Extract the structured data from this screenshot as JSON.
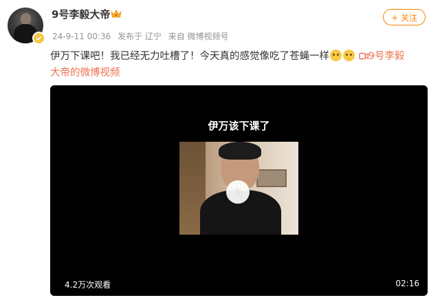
{
  "user": {
    "name": "9号李毅大帝",
    "badge_icon": "crown-icon",
    "verified_icon": "verified-check-icon"
  },
  "meta": {
    "timestamp": "24-9-11 00:36",
    "location": "发布于 辽宁",
    "source": "来自 微博视频号"
  },
  "follow_button": {
    "label": "+ 关注"
  },
  "post": {
    "text": "伊万下课吧！我已经无力吐槽了！今天真的感觉像吃了苍蝇一样",
    "emojis": [
      "crying-face-icon",
      "crying-face-icon"
    ],
    "link_icon": "video-camera-icon",
    "link_text_line1": "9号李毅",
    "link_text_line2": "大帝的微博视频"
  },
  "video": {
    "caption": "伊万该下课了",
    "play_icon": "play-icon",
    "views": "4.2万次观看",
    "duration": "02:16"
  },
  "colors": {
    "accent": "#ff8200",
    "link": "#eb7350",
    "text": "#333333",
    "meta": "#939393"
  }
}
